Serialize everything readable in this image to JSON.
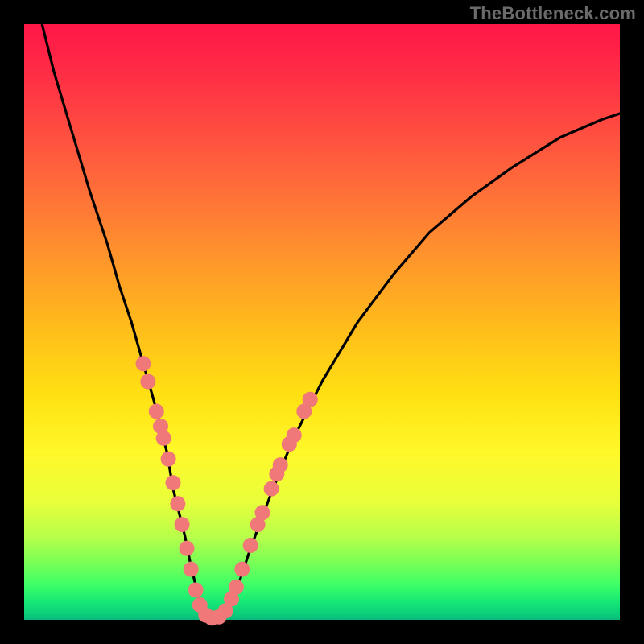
{
  "watermark": {
    "text": "TheBottleneck.com"
  },
  "chart_data": {
    "type": "line",
    "title": "",
    "xlabel": "",
    "ylabel": "",
    "xlim": [
      0,
      100
    ],
    "ylim": [
      0,
      100
    ],
    "grid": false,
    "legend": false,
    "series": [
      {
        "name": "bottleneck-curve",
        "x": [
          3,
          5,
          8,
          11,
          14,
          16,
          18,
          20,
          22,
          24,
          25,
          27,
          28,
          29,
          30,
          31,
          33,
          34,
          36,
          38,
          41,
          45,
          50,
          56,
          62,
          68,
          75,
          82,
          90,
          97,
          100
        ],
        "y": [
          100,
          92,
          82,
          72,
          63,
          56,
          50,
          43,
          36,
          28,
          22,
          14,
          9,
          5,
          2,
          0,
          0,
          2,
          6,
          12,
          20,
          30,
          40,
          50,
          58,
          65,
          71,
          76,
          81,
          84,
          85
        ]
      }
    ],
    "highlight_points": {
      "name": "marker-dots",
      "points": [
        {
          "x": 20.0,
          "y": 43.0
        },
        {
          "x": 20.8,
          "y": 40.0
        },
        {
          "x": 22.2,
          "y": 35.0
        },
        {
          "x": 22.9,
          "y": 32.5
        },
        {
          "x": 23.4,
          "y": 30.5
        },
        {
          "x": 24.2,
          "y": 27.0
        },
        {
          "x": 25.0,
          "y": 23.0
        },
        {
          "x": 25.8,
          "y": 19.5
        },
        {
          "x": 26.5,
          "y": 16.0
        },
        {
          "x": 27.3,
          "y": 12.0
        },
        {
          "x": 28.0,
          "y": 8.5
        },
        {
          "x": 28.8,
          "y": 5.0
        },
        {
          "x": 29.5,
          "y": 2.5
        },
        {
          "x": 30.5,
          "y": 0.8
        },
        {
          "x": 31.5,
          "y": 0.3
        },
        {
          "x": 32.7,
          "y": 0.5
        },
        {
          "x": 33.8,
          "y": 1.5
        },
        {
          "x": 34.8,
          "y": 3.5
        },
        {
          "x": 35.6,
          "y": 5.5
        },
        {
          "x": 36.6,
          "y": 8.5
        },
        {
          "x": 38.0,
          "y": 12.5
        },
        {
          "x": 39.2,
          "y": 16.0
        },
        {
          "x": 40.0,
          "y": 18.0
        },
        {
          "x": 41.5,
          "y": 22.0
        },
        {
          "x": 42.4,
          "y": 24.5
        },
        {
          "x": 43.0,
          "y": 26.0
        },
        {
          "x": 44.5,
          "y": 29.5
        },
        {
          "x": 45.3,
          "y": 31.0
        },
        {
          "x": 47.0,
          "y": 35.0
        },
        {
          "x": 48.0,
          "y": 37.0
        }
      ]
    },
    "background_gradient": {
      "top_color": "#ff1648",
      "bottom_color": "#09b87c",
      "description": "red-to-green vertical gradient"
    },
    "marker_color": "#f07878",
    "curve_color": "#000000"
  }
}
